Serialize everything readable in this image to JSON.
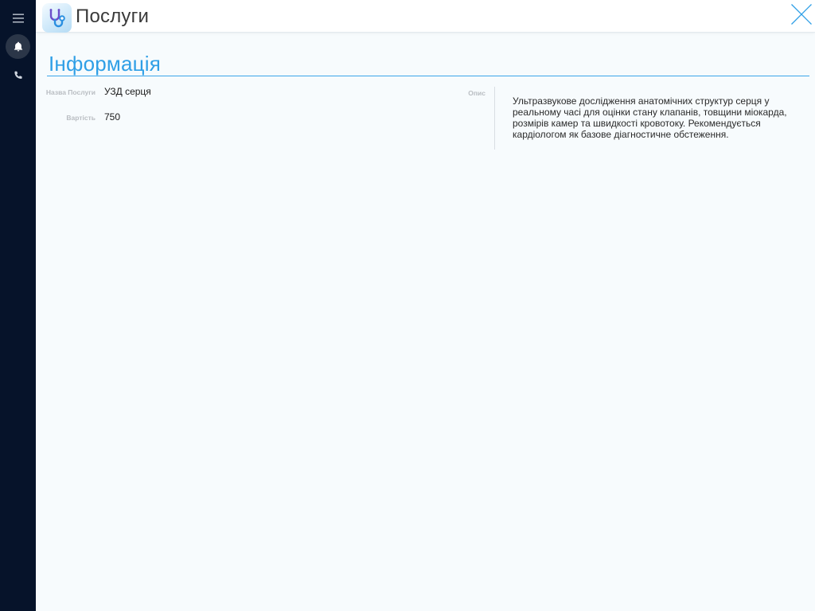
{
  "header": {
    "title": "Послуги",
    "app_icon": "stethoscope-icon",
    "close_icon": "close-icon"
  },
  "rail": {
    "items": [
      {
        "icon": "hamburger-menu-icon"
      },
      {
        "icon": "bell-icon",
        "active": true
      },
      {
        "icon": "phone-icon"
      }
    ]
  },
  "section": {
    "title": "Інформація"
  },
  "fields": {
    "name_label": "Назва Послуги",
    "name_value": "УЗД серця",
    "price_label": "Вартість",
    "price_value": "750",
    "description_label": "Опис",
    "description_value": "Ультразвукове дослідження анатомічних структур серця у реальному часі для оцінки стану клапанів, товщини міокарда, розмірів камер та швидкості кровотоку. Рекомендується кардіологом як базове діагностичне обстеження."
  },
  "colors": {
    "accent": "#2f9fe6",
    "rail_bg": "#06132a",
    "page_bg": "#f7fbfd"
  }
}
